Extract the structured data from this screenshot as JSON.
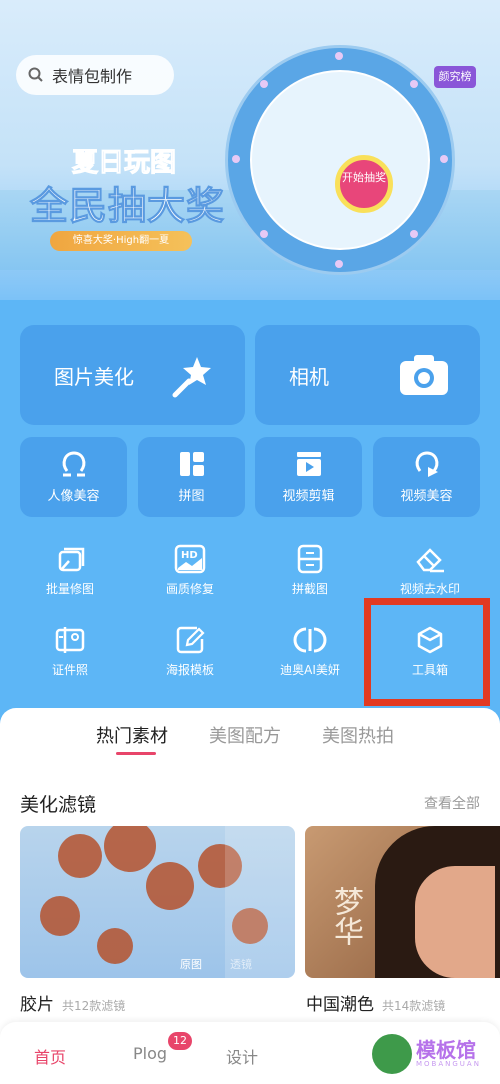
{
  "search": {
    "placeholder": "表情包制作"
  },
  "banner": {
    "title1": "夏日玩图",
    "title2": "全民抽大奖",
    "pill": "惊喜大奖·High翻一夏",
    "wheel_button": "开始抽奖",
    "badge": "颜究榜"
  },
  "big_cards": [
    {
      "label": "图片美化",
      "icon": "magic-wand-icon"
    },
    {
      "label": "相机",
      "icon": "camera-icon"
    }
  ],
  "small_cards": [
    {
      "label": "人像美容",
      "icon": "portrait-icon"
    },
    {
      "label": "拼图",
      "icon": "collage-icon"
    },
    {
      "label": "视频剪辑",
      "icon": "clapper-icon"
    },
    {
      "label": "视频美容",
      "icon": "video-beauty-icon"
    }
  ],
  "tools": [
    {
      "label": "批量修图",
      "icon": "batch-edit-icon"
    },
    {
      "label": "画质修复",
      "icon": "hd-icon"
    },
    {
      "label": "拼截图",
      "icon": "screenshot-stitch-icon"
    },
    {
      "label": "视频去水印",
      "icon": "eraser-icon"
    },
    {
      "label": "证件照",
      "icon": "id-photo-icon"
    },
    {
      "label": "海报模板",
      "icon": "poster-icon"
    },
    {
      "label": "迪奥AI美妍",
      "icon": "dior-icon"
    },
    {
      "label": "工具箱",
      "icon": "cube-icon"
    }
  ],
  "content_tabs": [
    "热门素材",
    "美图配方",
    "美图热拍"
  ],
  "section": {
    "title": "美化滤镜",
    "more": "查看全部"
  },
  "filters": [
    {
      "name": "胶片",
      "count": "共12款滤镜",
      "overlay": [
        "原图",
        "透镜"
      ]
    },
    {
      "name": "中国潮色",
      "count": "共14款滤镜",
      "overlay": [
        "梦华"
      ]
    }
  ],
  "bottom_nav": [
    {
      "label": "首页",
      "active": true
    },
    {
      "label": "Plog",
      "badge": "12"
    },
    {
      "label": "设计"
    }
  ],
  "watermark": {
    "text": "模板馆",
    "sub": "MOBANGUAN"
  },
  "colors": {
    "accent": "#e8456a",
    "highlight": "#e23a22",
    "card": "#4aa1ec"
  }
}
